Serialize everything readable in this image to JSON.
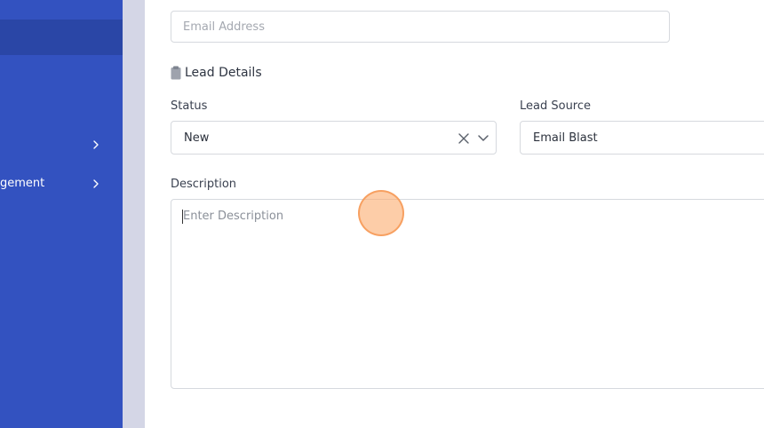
{
  "sidebar": {
    "items": [
      {
        "label": "",
        "has_chevron": true
      },
      {
        "label": "gement",
        "has_chevron": true
      }
    ],
    "background_color": "#3352c0",
    "active_color": "#2a46a6"
  },
  "form": {
    "email": {
      "placeholder": "Email Address",
      "value": ""
    },
    "lead_details": {
      "icon": "clipboard-icon",
      "title": "Lead Details"
    },
    "status": {
      "label": "Status",
      "value": "New"
    },
    "lead_source": {
      "label": "Lead Source",
      "value": "Email Blast"
    },
    "description": {
      "label": "Description",
      "placeholder": "Enter Description",
      "value": ""
    }
  },
  "accent_color": "#3352c0",
  "click_marker_color": "#fcac6e"
}
